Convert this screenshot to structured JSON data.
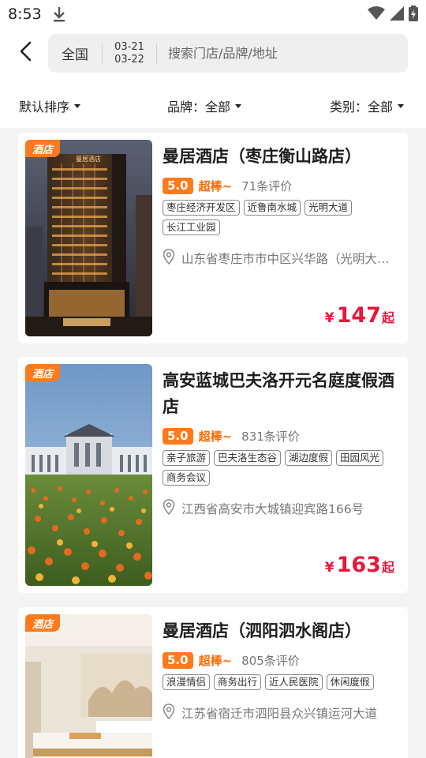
{
  "status": {
    "time": "8:53"
  },
  "header": {
    "city": "全国",
    "checkin": "03-21",
    "checkout": "03-22",
    "search_placeholder": "搜索门店/品牌/地址"
  },
  "filters": {
    "sort_label": "默认排序",
    "brand_label": "品牌：全部",
    "category_label": "类别：全部"
  },
  "hotels": [
    {
      "badge": "酒店",
      "name": "曼居酒店（枣庄衡山路店）",
      "score": "5.0",
      "score_word": "超棒~",
      "reviews": "71条评价",
      "tags": [
        "枣庄经济开发区",
        "近鲁南水城",
        "光明大道",
        "长江工业园"
      ],
      "address": "山东省枣庄市市中区兴华路（光明大道北侧）",
      "currency": "¥",
      "price": "147",
      "price_suffix": "起",
      "sign_text": "曼居酒店"
    },
    {
      "badge": "酒店",
      "name": "高安蓝城巴夫洛开元名庭度假酒店",
      "score": "5.0",
      "score_word": "超棒~",
      "reviews": "831条评价",
      "tags": [
        "亲子旅游",
        "巴夫洛生态谷",
        "湖边度假",
        "田园风光",
        "商务会议"
      ],
      "address": "江西省高安市大城镇迎宾路166号",
      "currency": "¥",
      "price": "163",
      "price_suffix": "起"
    },
    {
      "badge": "酒店",
      "name": "曼居酒店（泗阳泗水阁店）",
      "score": "5.0",
      "score_word": "超棒~",
      "reviews": "805条评价",
      "tags": [
        "浪漫情侣",
        "商务出行",
        "近人民医院",
        "休闲度假"
      ],
      "address": "江苏省宿迁市泗阳县众兴镇运河大道",
      "currency": "¥",
      "price": "",
      "price_suffix": ""
    }
  ],
  "colors": {
    "accent": "#ff7a1c",
    "price": "#e8173a",
    "background": "#f4f4f4"
  },
  "icons": {
    "back": "chevron-left-icon",
    "download": "download-icon",
    "wifi": "wifi-icon",
    "signal": "signal-icon",
    "battery": "battery-icon",
    "location": "location-pin-icon"
  }
}
